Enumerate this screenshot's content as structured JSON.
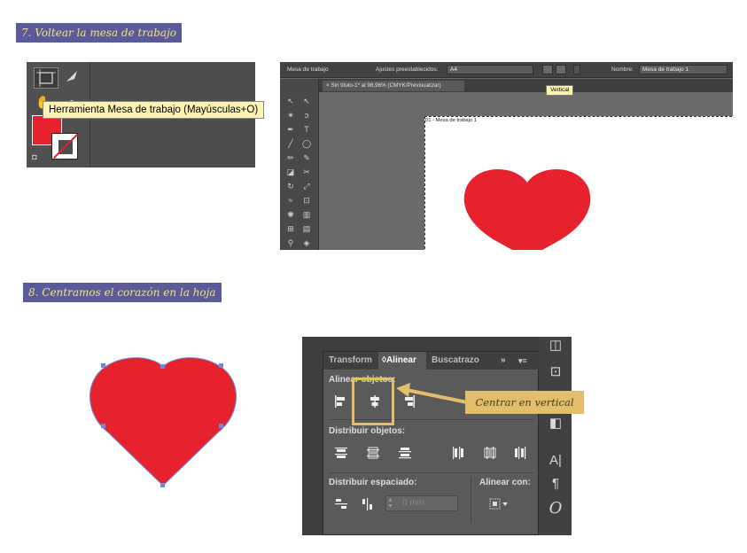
{
  "step7": {
    "title": "7. Voltear la mesa de trabajo"
  },
  "step8": {
    "title": "8. Centramos el corazón en la hoja"
  },
  "shot1": {
    "tooltip": "Herramienta Mesa de trabajo (Mayúsculas+O)",
    "colors": {
      "fill": "#e8212f",
      "stroke": "#ffffff",
      "panel": "#4d4d4d"
    }
  },
  "shot2": {
    "control_bar": {
      "tool_label": "Mesa de trabajo",
      "presets_label": "Ajustes preestablecidos:",
      "presets_value": "A4",
      "name_label": "Nombre:",
      "name_value": "Mesa de trabajo 1"
    },
    "document_tab": "Sin título-1* al 98,96% (CMYK/Previsualizar)",
    "artboard_label": "01 - Mesa de trabajo 1",
    "tooltip": "Vertical"
  },
  "heart_color": "#e8212f",
  "align_panel": {
    "tabs": [
      "Transform",
      "Alinear",
      "Buscatrazo"
    ],
    "sections": {
      "align_objects": "Alinear objetos:",
      "distribute_objects": "Distribuir objetos:",
      "distribute_spacing": "Distribuir espaciado:",
      "align_to": "Alinear con:"
    },
    "spacing_value": "0 mm"
  },
  "callout": {
    "text": "Centrar en vertical",
    "color": "#e0be6c"
  }
}
